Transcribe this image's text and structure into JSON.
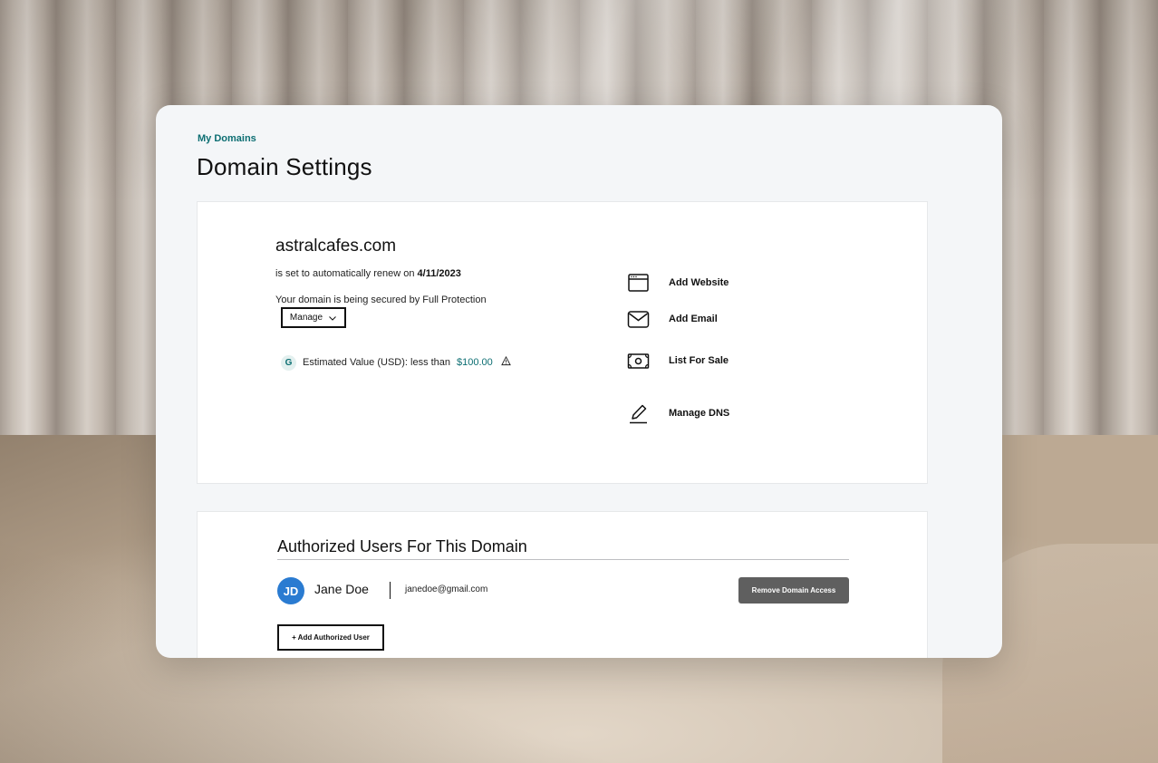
{
  "breadcrumb": "My Domains",
  "page_title": "Domain Settings",
  "domain": {
    "name": "astralcafes.com",
    "renew_prefix": "is set to automatically renew on",
    "renew_date": "4/11/2023",
    "protection_text": "Your domain is being secured by Full Protection",
    "manage_label": "Manage",
    "value_badge": "G",
    "value_label": "Estimated Value (USD): less than",
    "value_amount": "$100.00"
  },
  "actions": [
    {
      "label": "Add Website",
      "icon": "browser-window-icon"
    },
    {
      "label": "Add Email",
      "icon": "envelope-icon"
    },
    {
      "label": "List For Sale",
      "icon": "banknote-icon"
    },
    {
      "label": "Manage DNS",
      "icon": "pencil-icon"
    }
  ],
  "users_section": {
    "title": "Authorized Users For This Domain",
    "users": [
      {
        "initials": "JD",
        "name": "Jane Doe",
        "email": "janedoe@gmail.com"
      }
    ],
    "remove_label": "Remove Domain Access",
    "add_label": "+ Add Authorized User"
  },
  "colors": {
    "accent_teal": "#0c6e72",
    "avatar_blue": "#2a7bd1",
    "remove_button_gray": "#5f5f5f"
  }
}
